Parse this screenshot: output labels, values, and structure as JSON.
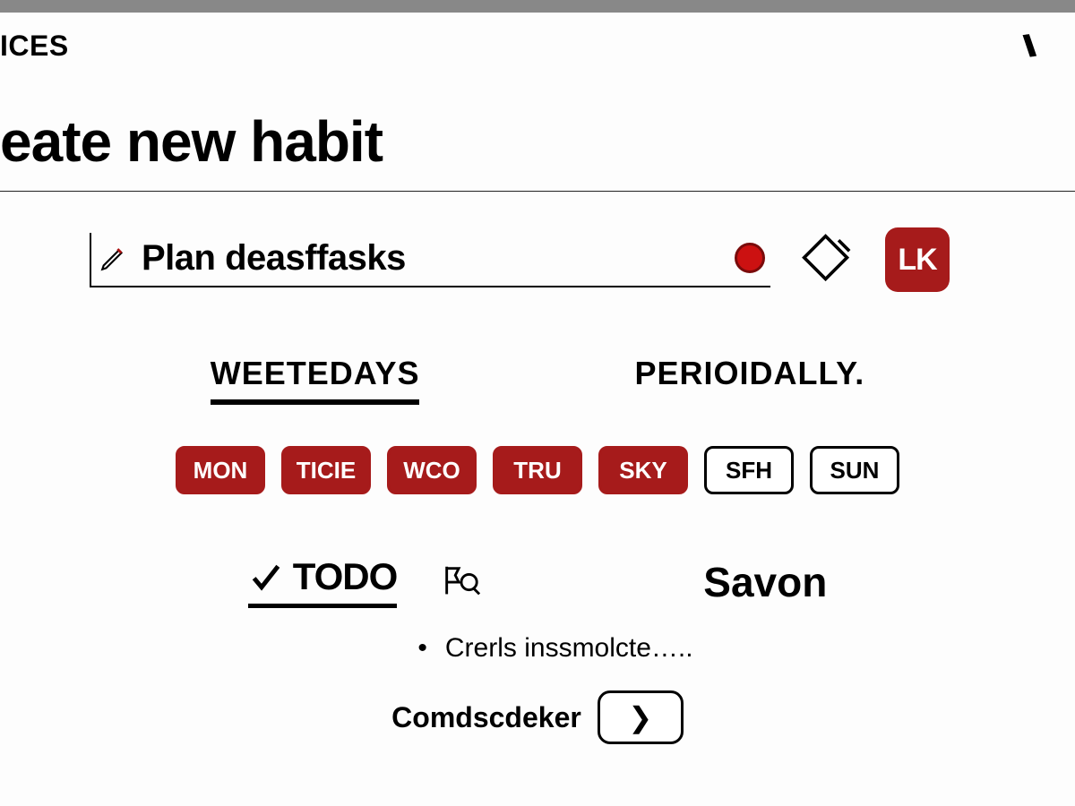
{
  "header": {
    "crumb": "ICES"
  },
  "title": "eate new habit",
  "form": {
    "name_value": "Plan deasffasks",
    "color": "#c41818",
    "confirm_label": "LK"
  },
  "tabs": {
    "weekdays": "WEETEDAYS",
    "periodically": "PERIOIDALLY."
  },
  "days": [
    {
      "label": "MON",
      "on": true
    },
    {
      "label": "TICIE",
      "on": true
    },
    {
      "label": "WCO",
      "on": true
    },
    {
      "label": "TRU",
      "on": true
    },
    {
      "label": "SKY",
      "on": true
    },
    {
      "label": "SFH",
      "on": false
    },
    {
      "label": "SUN",
      "on": false
    }
  ],
  "tags": {
    "todo": "TODO",
    "savon": "Savon"
  },
  "note": "Crerls inssmolcte…..",
  "picker": {
    "label": "Comdscdeker",
    "glyph": "✦"
  }
}
